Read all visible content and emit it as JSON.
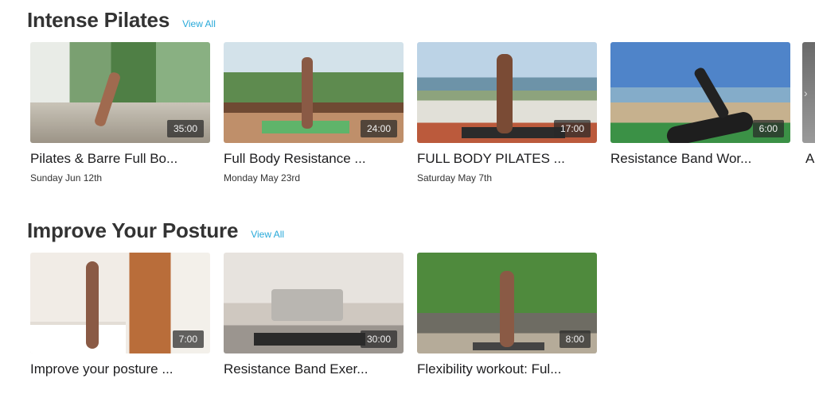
{
  "sections": [
    {
      "title": "Intense Pilates",
      "view_all": "View All",
      "cards": [
        {
          "title": "Pilates & Barre Full Bo...",
          "date": "Sunday Jun 12th",
          "duration": "35:00"
        },
        {
          "title": "Full Body Resistance ...",
          "date": "Monday May 23rd",
          "duration": "24:00"
        },
        {
          "title": "FULL BODY PILATES ...",
          "date": "Saturday May 7th",
          "duration": "17:00"
        },
        {
          "title": "Resistance Band Wor...",
          "date": "",
          "duration": "6:00"
        }
      ],
      "partial_card": {
        "title": "A",
        "icon": "chevron-right-icon"
      }
    },
    {
      "title": "Improve Your Posture",
      "view_all": "View All",
      "cards": [
        {
          "title": "Improve your posture ...",
          "duration": "7:00"
        },
        {
          "title": "Resistance Band Exer...",
          "duration": "30:00"
        },
        {
          "title": "Flexibility workout: Ful...",
          "duration": "8:00"
        }
      ]
    }
  ],
  "colors": {
    "link": "#28a9d9",
    "heading": "#333333"
  }
}
